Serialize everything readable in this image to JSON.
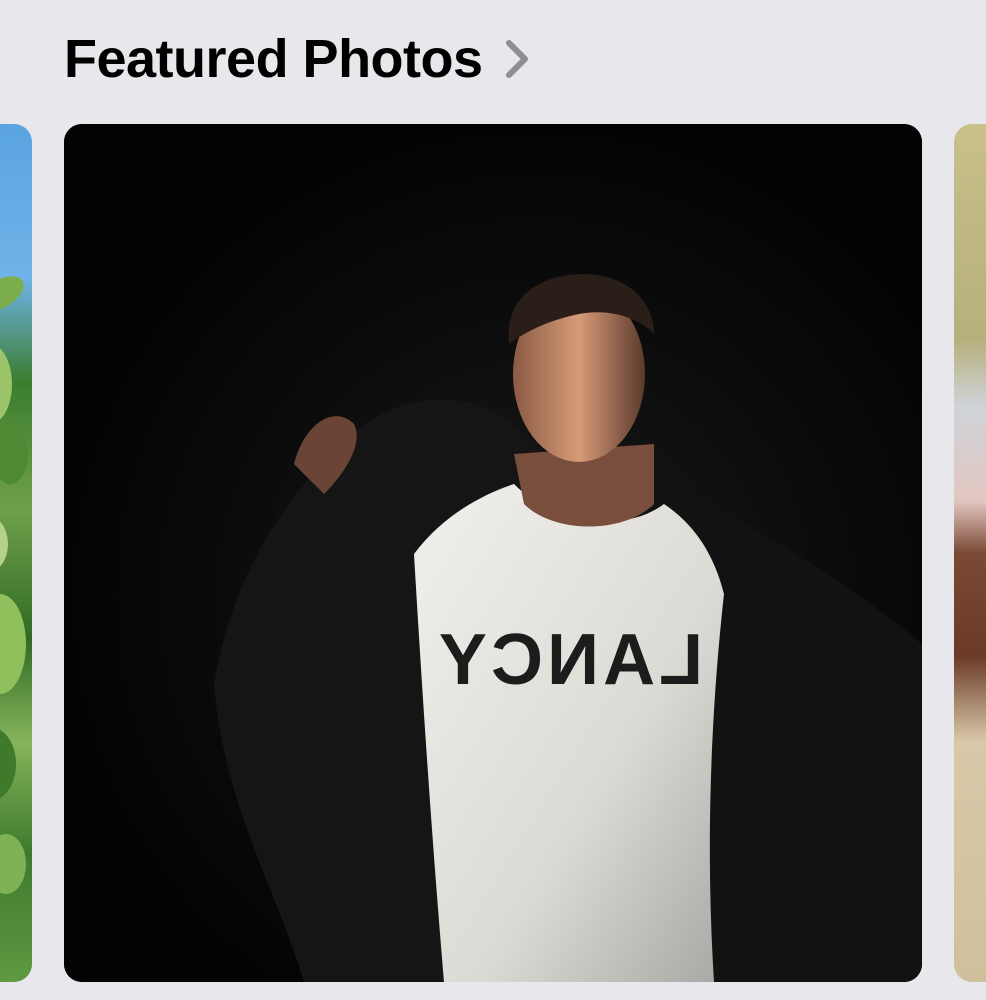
{
  "section": {
    "title": "Featured Photos",
    "chevron_icon": "chevron-right-icon"
  },
  "carousel": {
    "cards": [
      {
        "name": "featured-photo-card-previous",
        "subject": "leaves-and-sky"
      },
      {
        "name": "featured-photo-card-current",
        "subject": "performer-on-dark-stage",
        "shirt_text": "LANCY"
      },
      {
        "name": "featured-photo-card-next",
        "subject": "interior-scene"
      }
    ]
  },
  "colors": {
    "background": "#e8e8ec",
    "title": "#000000",
    "chevron": "#8e8e93"
  }
}
